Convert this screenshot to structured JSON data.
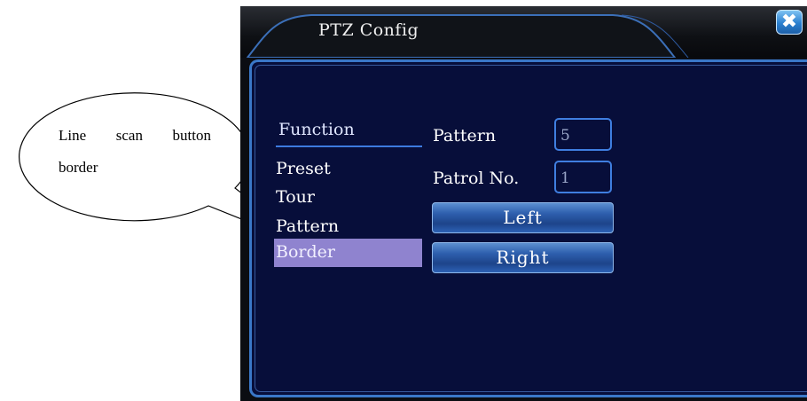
{
  "callout": {
    "line1": "Line scan button",
    "line2": "border"
  },
  "window": {
    "title": "PTZ Config",
    "close_symbol": "✖"
  },
  "menu": {
    "heading": "Function",
    "items": [
      "Preset",
      "Tour",
      "Pattern",
      "Border"
    ],
    "selected": "Border"
  },
  "fields": {
    "pattern": {
      "label": "Pattern",
      "value": "5"
    },
    "patrol": {
      "label": "Patrol No.",
      "value": "1"
    }
  },
  "buttons": {
    "left": "Left",
    "right": "Right"
  },
  "colors": {
    "panel_bg": "#070e3a",
    "accent_blue": "#3a78c8",
    "selected_bg": "#8f83cf"
  }
}
